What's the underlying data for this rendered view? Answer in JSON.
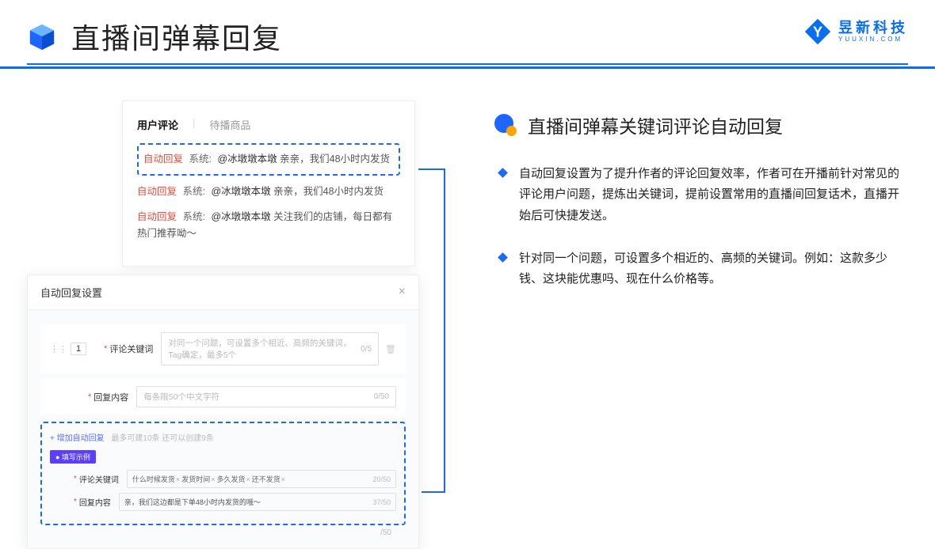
{
  "header": {
    "title": "直播间弹幕回复"
  },
  "brand": {
    "cn": "昱新科技",
    "en": "YUUXIN.COM"
  },
  "panel1": {
    "tab_active": "用户评论",
    "tab_inactive": "待播商品",
    "comments": {
      "auto_label": "自动回复",
      "sys_label": "系统:",
      "c1_at": "@冰墩墩本墩",
      "c1_text": " 亲亲，我们48小时内发货",
      "c2_at": "@冰墩墩本墩",
      "c2_text": " 亲亲，我们48小时内发货",
      "c3_at": "@冰墩墩本墩",
      "c3_text": " 关注我们的店铺，每日都有热门推荐呦～"
    }
  },
  "panel2": {
    "title": "自动回复设置",
    "close": "×",
    "idx": "1",
    "row1_label": "评论关键词",
    "row1_placeholder": "对同一个问题，可设置多个相近、高频的关键词，Tag确定，最多5个",
    "row1_count": "0/5",
    "row2_label": "回复内容",
    "row2_placeholder": "每条限50个中文字符",
    "row2_count": "0/50",
    "add_link": "+ 增加自动回复",
    "add_hint": "最多可建10条 还可以创建9条",
    "example_badge": "● 填写示例",
    "ex_row1_label": "评论关键词",
    "ex_tags": [
      "什么时候发货",
      "发货时间",
      "多久发货",
      "还不发货"
    ],
    "ex_row1_count": "20/50",
    "ex_row2_label": "回复内容",
    "ex_row2_text": "亲，我们这边都是下单48小时内发货的哦～",
    "ex_row2_count": "37/50",
    "tail_count": "/50"
  },
  "right": {
    "section_title": "直播间弹幕关键词评论自动回复",
    "bullet1": "自动回复设置为了提升作者的评论回复效率，作者可在开播前针对常见的评论用户问题，提炼出关键词，提前设置常用的直播间回复话术，直播开始后可快捷发送。",
    "bullet2": "针对同一个问题，可设置多个相近的、高频的关键词。例如：这款多少钱、这块能优惠吗、现在什么价格等。"
  }
}
